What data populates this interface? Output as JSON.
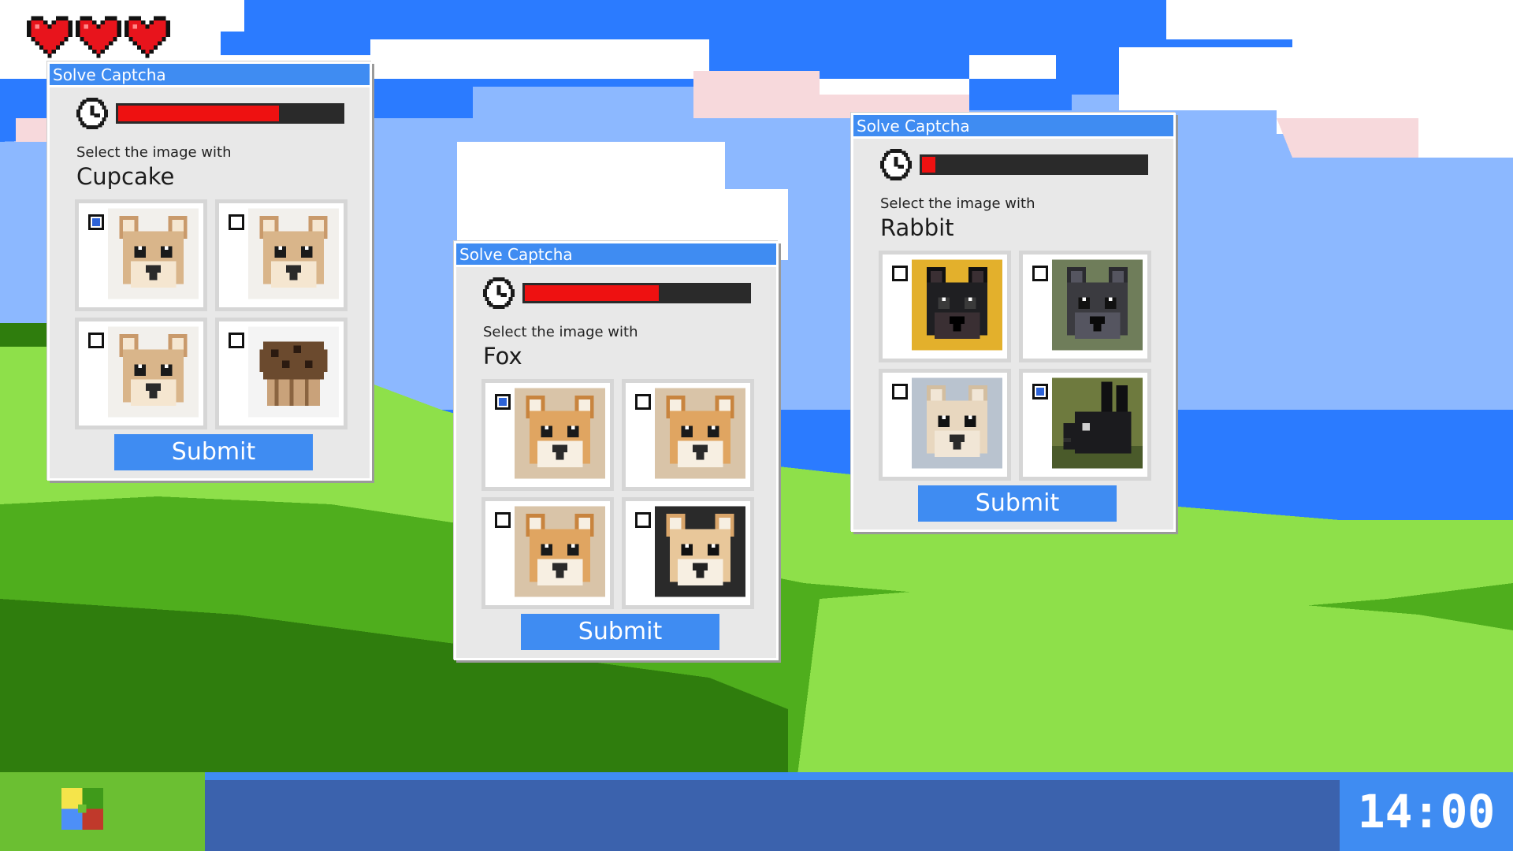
{
  "lives": {
    "count": 3,
    "color": "#e8141c"
  },
  "windows": [
    {
      "title": "Solve Captcha",
      "timer_fraction": 0.72,
      "prompt": "Select the image with",
      "target": "Cupcake",
      "submit_label": "Submit",
      "tiles": [
        {
          "subject": "chihuahua",
          "checked": true
        },
        {
          "subject": "chihuahua",
          "checked": false
        },
        {
          "subject": "chihuahua",
          "checked": false
        },
        {
          "subject": "cupcake",
          "checked": false
        }
      ]
    },
    {
      "title": "Solve Captcha",
      "timer_fraction": 0.6,
      "prompt": "Select the image with",
      "target": "Fox",
      "submit_label": "Submit",
      "tiles": [
        {
          "subject": "shiba",
          "checked": true
        },
        {
          "subject": "shiba",
          "checked": false
        },
        {
          "subject": "shiba",
          "checked": false
        },
        {
          "subject": "fox",
          "checked": false
        }
      ]
    },
    {
      "title": "Solve Captcha",
      "timer_fraction": 0.06,
      "prompt": "Select the image with",
      "target": "Rabbit",
      "submit_label": "Submit",
      "tiles": [
        {
          "subject": "french-bulldog-black",
          "checked": false
        },
        {
          "subject": "french-bulldog-gray",
          "checked": false
        },
        {
          "subject": "french-bulldog-fawn",
          "checked": false
        },
        {
          "subject": "rabbit-black",
          "checked": true
        }
      ]
    }
  ],
  "taskbar": {
    "time": "14:00",
    "start_icon": "pixel-logo-icon"
  },
  "colors": {
    "sky": "#2b7bff",
    "sky_light": "#8cb8ff",
    "hill_light": "#8ee04a",
    "hill_mid": "#4fae1d",
    "hill_dark": "#2f7d0d",
    "title_blue": "#3f8cf2",
    "timer_red": "#ee1111"
  }
}
